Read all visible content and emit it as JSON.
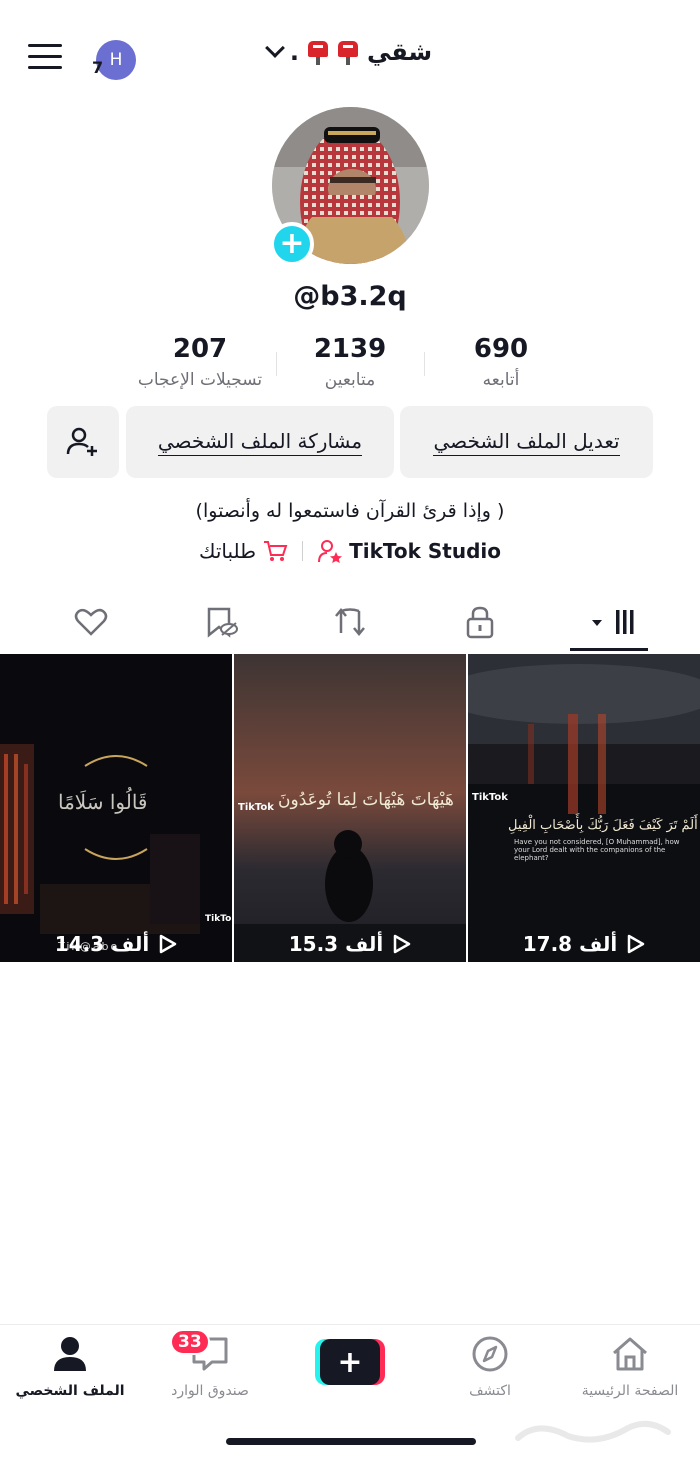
{
  "header": {
    "account_badge_letter": "H",
    "account_badge_count": "7",
    "display_name": "شقي",
    "name_suffix": "."
  },
  "profile": {
    "username": "@b3.2q",
    "add_badge": "+",
    "stats": {
      "following": {
        "value": "690",
        "label": "أتابعه"
      },
      "followers": {
        "value": "2139",
        "label": "متابعين"
      },
      "likes": {
        "value": "207",
        "label": "تسجيلات الإعجاب"
      }
    },
    "buttons": {
      "edit_profile": "تعديل الملف الشخصي",
      "share_profile": "مشاركة الملف الشخصي"
    },
    "bio": "(وإذا قرئ القرآن فاستمعوا له وأنصتوا )",
    "links": {
      "studio": "TikTok Studio",
      "orders": "طلباتك"
    }
  },
  "videos": [
    {
      "views": "17.8 ألف",
      "caption": "أَلَمْ تَرَ كَيْفَ فَعَلَ رَبُّكَ بِأَصْحَابِ الْفِيلِ",
      "subcaption": "Have you not considered, [O Muhammad], how your Lord dealt with the companions of the elephant?",
      "logo": "TikTok"
    },
    {
      "views": "15.3 ألف",
      "caption": "هَيْهَاتَ هَيْهَاتَ لِمَا تُوعَدُونَ",
      "logo": "TikTok"
    },
    {
      "views": "14.3 ألف",
      "caption": "قَالُوا سَلَامًا",
      "logo": "TikTok",
      "watermark": "Tik@abo"
    }
  ],
  "nav": {
    "home": "الصفحة الرئيسية",
    "discover": "اكتشف",
    "create": "+",
    "inbox": "صندوق الوارد",
    "inbox_badge": "33",
    "profile": "الملف الشخصي"
  },
  "colors": {
    "accent_cyan": "#20d5ec",
    "accent_red": "#fe2c55",
    "text": "#161823"
  }
}
